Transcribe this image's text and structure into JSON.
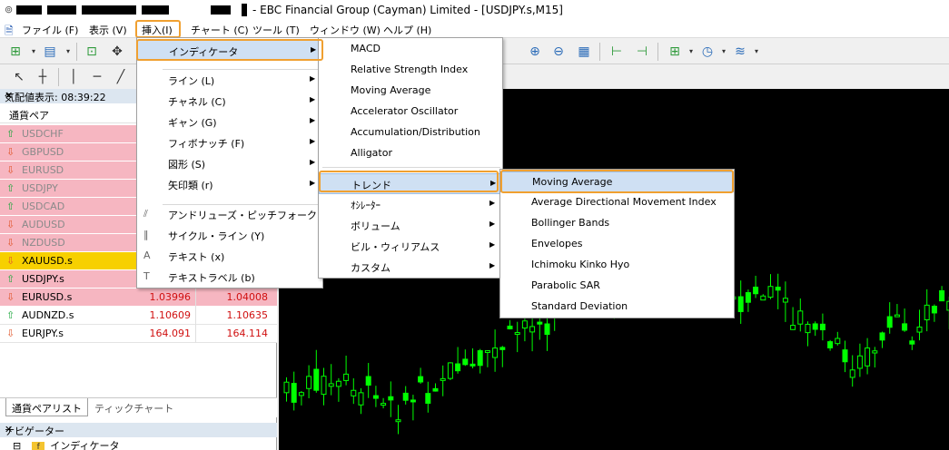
{
  "title_bar": {
    "text": "- EBC Financial Group (Cayman) Limited - [USDJPY.s,M15]"
  },
  "menu_bar": {
    "items": [
      "ファイル (F)",
      "表示 (V)",
      "挿入(I)",
      "チャート (C)",
      "ツール (T)",
      "ウィンドウ (W)",
      "ヘルプ (H)"
    ]
  },
  "market_watch": {
    "header": "気配値表示: 08:39:22",
    "column_header": "通貨ペア",
    "rows": [
      {
        "symbol": "USDCHF",
        "dir": "up",
        "bid": "",
        "ask": ""
      },
      {
        "symbol": "GBPUSD",
        "dir": "down",
        "bid": "",
        "ask": ""
      },
      {
        "symbol": "EURUSD",
        "dir": "down",
        "bid": "",
        "ask": ""
      },
      {
        "symbol": "USDJPY",
        "dir": "up",
        "bid": "",
        "ask": ""
      },
      {
        "symbol": "USDCAD",
        "dir": "up",
        "bid": "",
        "ask": ""
      },
      {
        "symbol": "AUDUSD",
        "dir": "down",
        "bid": "",
        "ask": ""
      },
      {
        "symbol": "NZDUSD",
        "dir": "down",
        "bid": "",
        "ask": ""
      },
      {
        "symbol": "XAUUSD.s",
        "dir": "down",
        "bid": "",
        "ask": ""
      },
      {
        "symbol": "USDJPY.s",
        "dir": "up",
        "bid": "",
        "ask": ""
      },
      {
        "symbol": "EURUSD.s",
        "dir": "down",
        "bid": "1.03996",
        "ask": "1.04008"
      },
      {
        "symbol": "AUDNZD.s",
        "dir": "up",
        "bid": "1.10609",
        "ask": "1.10635"
      },
      {
        "symbol": "EURJPY.s",
        "dir": "down",
        "bid": "164.091",
        "ask": "164.114"
      }
    ],
    "tabs": [
      "通貨ペアリスト",
      "ティックチャート"
    ]
  },
  "navigator": {
    "header": "ナビゲーター",
    "item": "インディケータ",
    "item_icon": "f"
  },
  "insert_menu": {
    "items": [
      {
        "label": "インディケータ",
        "has_sub": true
      },
      {
        "label": "ライン (L)",
        "has_sub": true
      },
      {
        "label": "チャネル (C)",
        "has_sub": true
      },
      {
        "label": "ギャン (G)",
        "has_sub": true
      },
      {
        "label": "フィボナッチ (F)",
        "has_sub": true
      },
      {
        "label": "図形 (S)",
        "has_sub": true
      },
      {
        "label": "矢印類 (r)",
        "has_sub": true
      },
      {
        "label": "アンドリューズ・ピッチフォーク (A)",
        "has_sub": false
      },
      {
        "label": "サイクル・ライン (Y)",
        "has_sub": false
      },
      {
        "label": "テキスト (x)",
        "has_sub": false,
        "icon": "A"
      },
      {
        "label": "テキストラベル (b)",
        "has_sub": false,
        "icon": "T"
      }
    ]
  },
  "indicator_menu": {
    "items": [
      {
        "label": "MACD",
        "has_sub": false
      },
      {
        "label": "Relative Strength Index",
        "has_sub": false
      },
      {
        "label": "Moving Average",
        "has_sub": false
      },
      {
        "label": "Accelerator Oscillator",
        "has_sub": false
      },
      {
        "label": "Accumulation/Distribution",
        "has_sub": false
      },
      {
        "label": "Alligator",
        "has_sub": false
      },
      {
        "label": "トレンド",
        "has_sub": true
      },
      {
        "label": "ｵｼﾚｰﾀｰ",
        "has_sub": true
      },
      {
        "label": "ボリューム",
        "has_sub": true
      },
      {
        "label": "ビル・ウィリアムス",
        "has_sub": true
      },
      {
        "label": "カスタム",
        "has_sub": true
      }
    ]
  },
  "trend_menu": {
    "items": [
      "Moving Average",
      "Average Directional Movement Index",
      "Bollinger Bands",
      "Envelopes",
      "Ichimoku Kinko Hyo",
      "Parabolic SAR",
      "Standard Deviation"
    ]
  },
  "colors": {
    "up_arrow": "#1aa53a",
    "down_arrow": "#e0552a",
    "row_pink": "#f6b6c1",
    "row_gold": "#f7d000",
    "highlight_outline": "#f0a030",
    "candle_up": "#00ff00",
    "chart_bg": "#000000"
  }
}
